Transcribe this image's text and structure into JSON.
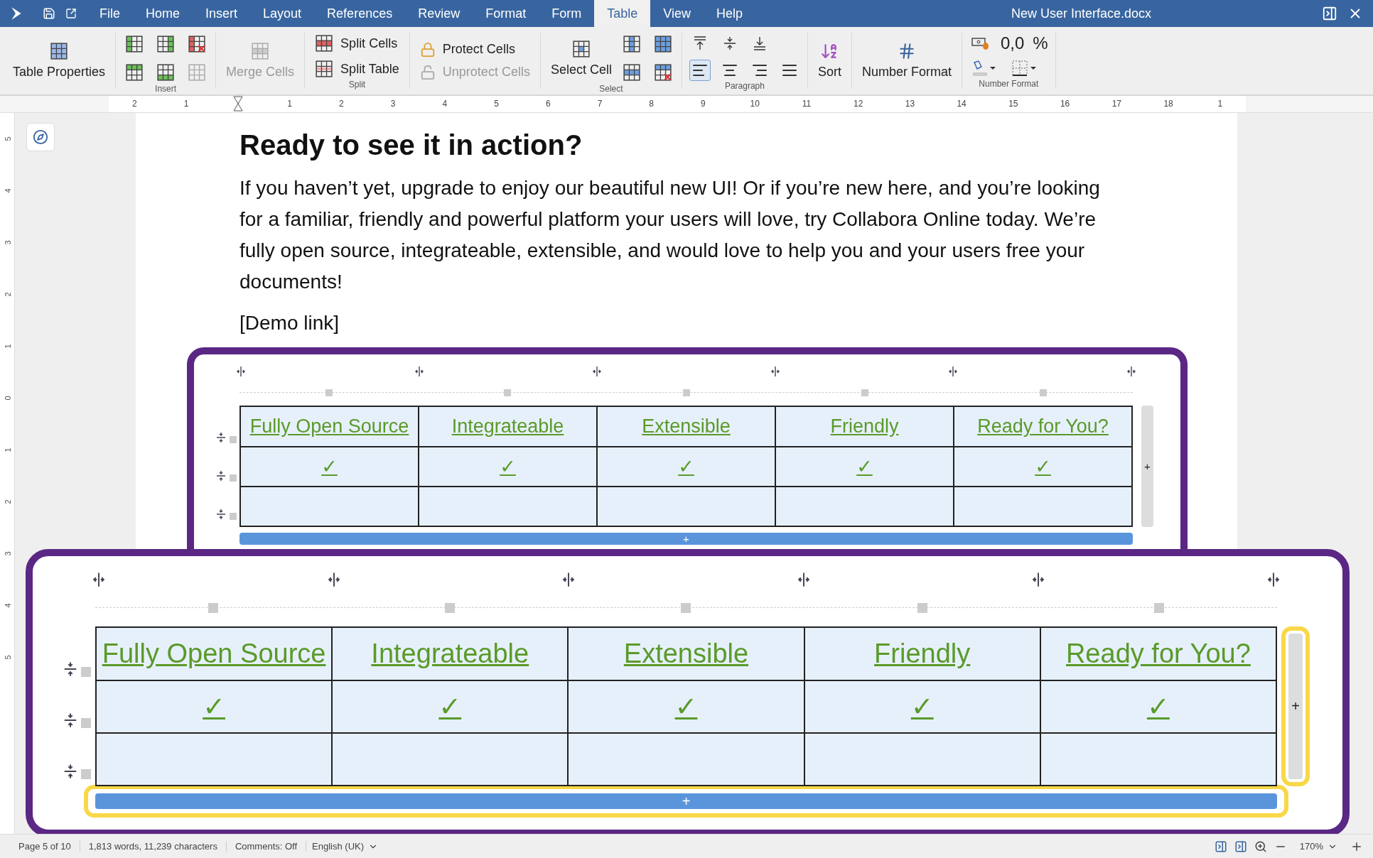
{
  "window": {
    "title": "New User Interface.docx"
  },
  "menu": [
    {
      "label": "File",
      "selected": false
    },
    {
      "label": "Home",
      "selected": false
    },
    {
      "label": "Insert",
      "selected": false
    },
    {
      "label": "Layout",
      "selected": false
    },
    {
      "label": "References",
      "selected": false
    },
    {
      "label": "Review",
      "selected": false
    },
    {
      "label": "Format",
      "selected": false
    },
    {
      "label": "Form",
      "selected": false
    },
    {
      "label": "Table",
      "selected": true
    },
    {
      "label": "View",
      "selected": false
    },
    {
      "label": "Help",
      "selected": false
    }
  ],
  "toolbar": {
    "table_properties": "Table Properties",
    "insert_caption": "Insert",
    "merge_cells": {
      "label": "Merge Cells",
      "disabled": true
    },
    "split": {
      "caption": "Split",
      "items": [
        {
          "label": "Split Cells"
        },
        {
          "label": "Split Table"
        }
      ]
    },
    "protect": [
      {
        "label": "Protect Cells",
        "disabled": false
      },
      {
        "label": "Unprotect Cells",
        "disabled": true
      }
    ],
    "select": {
      "label": "Select Cell",
      "caption": "Select"
    },
    "paragraph": {
      "caption": "Paragraph",
      "alignments": [
        {
          "selected": true
        },
        {
          "selected": false
        },
        {
          "selected": false
        },
        {
          "selected": false
        }
      ]
    },
    "sort": "Sort",
    "number_format": "Number Format",
    "number_format_group": {
      "caption": "Number Format",
      "decimal": "0,0",
      "percent": "%"
    }
  },
  "ruler": {
    "left_labels": [
      "2",
      "1"
    ],
    "labels": [
      "1",
      "2",
      "3",
      "4",
      "5",
      "6",
      "7",
      "8",
      "9",
      "10",
      "11",
      "12",
      "13",
      "14",
      "15",
      "16",
      "17",
      "18",
      "1"
    ]
  },
  "vertical_ruler": [
    "5",
    "4",
    "3",
    "2",
    "1",
    "0",
    "1",
    "2",
    "3",
    "4",
    "5"
  ],
  "document": {
    "heading": "Ready to see it in action?",
    "paragraph": "If you haven’t yet, upgrade to enjoy our beautiful new UI! Or if you’re new here, and you’re looking for a familiar, friendly and powerful platform your users will love, try Collabora Online today. We’re fully open source, integrateable, extensible, and would love to help you and your users free your documents!",
    "demo_link": "[Demo link]",
    "table": {
      "headers": [
        "Fully Open Source",
        "Integrateable",
        "Extensible",
        "Friendly",
        "Ready for You?"
      ],
      "checks": [
        "✓",
        "✓",
        "✓",
        "✓",
        "✓"
      ],
      "add_row": "+",
      "add_column": "+"
    }
  },
  "callout": {
    "table": {
      "headers": [
        "Fully Open Source",
        "Integrateable",
        "Extensible",
        "Friendly",
        "Ready for You?"
      ],
      "checks": [
        "✓",
        "✓",
        "✓",
        "✓",
        "✓"
      ],
      "add_row": "+",
      "add_column": "+"
    }
  },
  "status_bar": {
    "page": "Page 5 of 10",
    "counts": "1,813 words, 11,239 characters",
    "comments": "Comments: Off",
    "language": "English (UK)",
    "zoom": "170%"
  }
}
